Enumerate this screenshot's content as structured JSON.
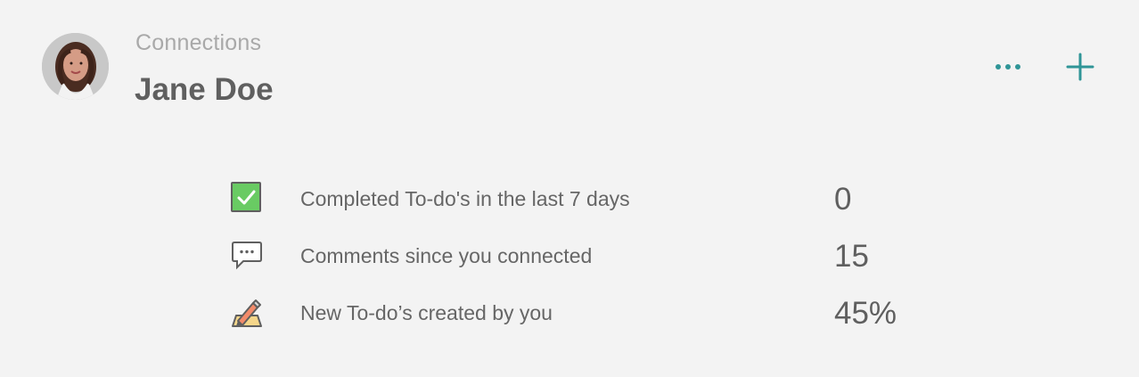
{
  "header": {
    "breadcrumb": "Connections",
    "title": "Jane Doe",
    "avatar_icon": "user-avatar",
    "actions": [
      {
        "icon": "more-dots-icon",
        "color": "#2f9597"
      },
      {
        "icon": "plus-icon",
        "color": "#2f9597"
      }
    ]
  },
  "stats": [
    {
      "icon": "checkbox-icon",
      "label": "Completed To-do's in the last 7 days",
      "value": "0"
    },
    {
      "icon": "comment-icon",
      "label": "Comments since you connected",
      "value": "15"
    },
    {
      "icon": "pencil-paper-icon",
      "label": "New To-do’s created by you",
      "value": "45%"
    }
  ],
  "colors": {
    "background": "#f3f3f3",
    "accent": "#2f9597",
    "text": "#5f5f5f",
    "muted": "#a9a9a9",
    "success": "#69cb63"
  }
}
